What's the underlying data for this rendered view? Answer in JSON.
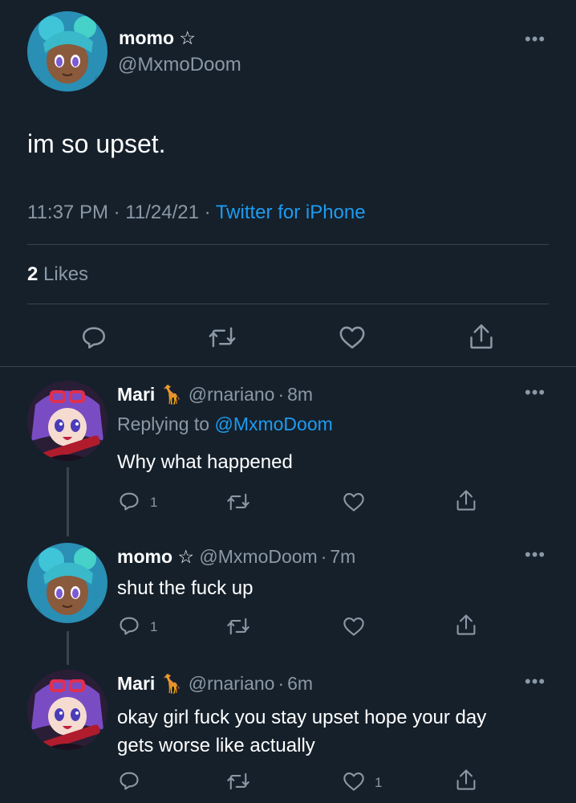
{
  "main_tweet": {
    "author_name": "momo",
    "author_badge": "☆",
    "author_handle": "@MxmoDoom",
    "text": "im so upset.",
    "time": "11:37 PM",
    "sep1": "·",
    "date": "11/24/21",
    "sep2": "·",
    "source": "Twitter for iPhone",
    "likes_count": "2",
    "likes_label": "Likes",
    "more_label": "•••"
  },
  "replies": [
    {
      "author_name": "Mari",
      "author_emoji": "🦒",
      "author_handle": "@rnariano",
      "dot": "·",
      "time": "8m",
      "replying_prefix": "Replying to",
      "replying_handle": "@MxmoDoom",
      "text": "Why what happened",
      "reply_count": "1",
      "retweet_count": "",
      "like_count": "",
      "more_label": "•••"
    },
    {
      "author_name": "momo",
      "author_badge": "☆",
      "author_handle": "@MxmoDoom",
      "dot": "·",
      "time": "7m",
      "text": "shut the fuck up",
      "reply_count": "1",
      "retweet_count": "",
      "like_count": "",
      "more_label": "•••"
    },
    {
      "author_name": "Mari",
      "author_emoji": "🦒",
      "author_handle": "@rnariano",
      "dot": "·",
      "time": "6m",
      "text_line1": "okay girl fuck you stay upset hope your day",
      "text_line2": "gets worse like actually",
      "reply_count": "",
      "retweet_count": "",
      "like_count": "1",
      "more_label": "•••"
    }
  ],
  "icons": {
    "reply": "reply-icon",
    "retweet": "retweet-icon",
    "like": "heart-icon",
    "share": "share-icon",
    "more": "more-icon"
  },
  "colors": {
    "background": "#15202b",
    "muted": "#8b98a5",
    "link": "#1d9bf0",
    "divider": "#38444d"
  }
}
